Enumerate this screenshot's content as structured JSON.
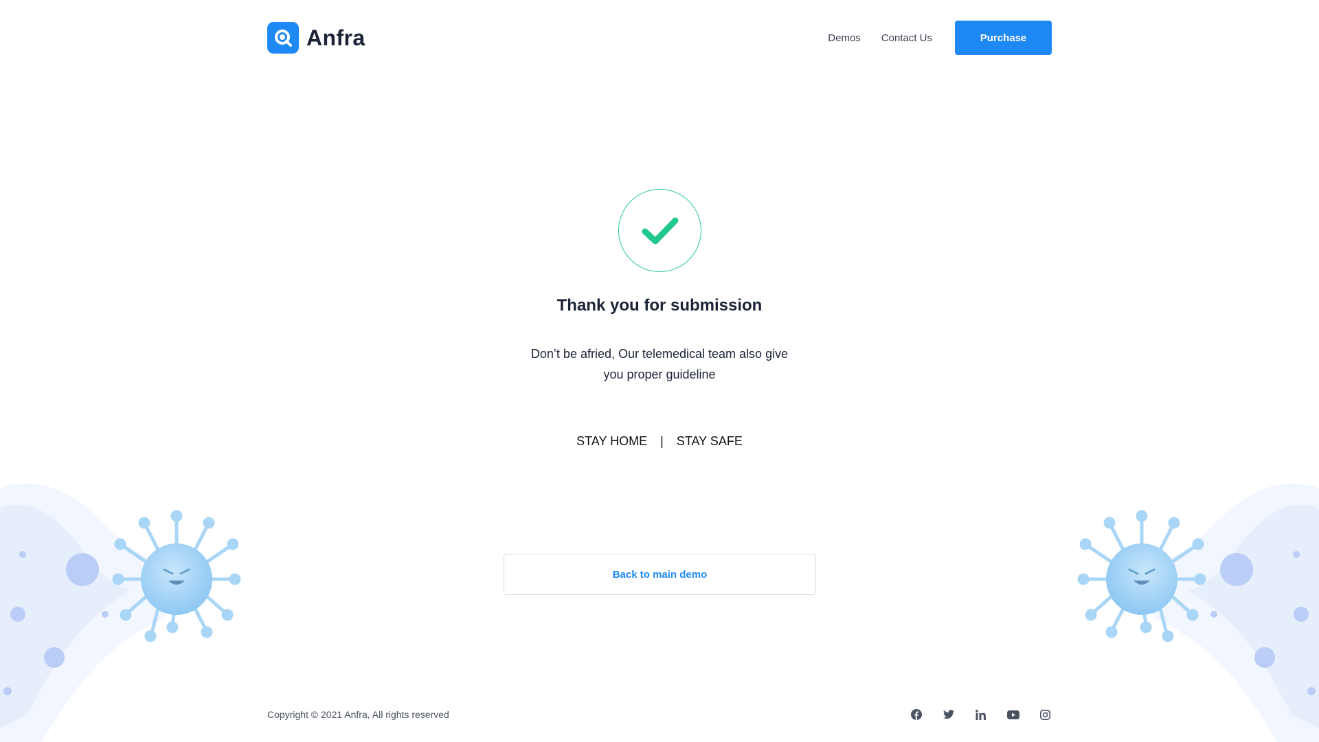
{
  "brand": {
    "name": "Anfra",
    "logo_icon": "search-icon",
    "accent": "#1e88f5"
  },
  "nav": {
    "demos_label": "Demos",
    "contact_label": "Contact Us",
    "purchase_label": "Purchase"
  },
  "main": {
    "status_icon": "checkmark-icon",
    "success_color": "#22c98a",
    "title": "Thank you for submission",
    "message_line1": "Don’t be afried, Our telemedical team also give",
    "message_line2": "you proper guideline",
    "stay_home": "STAY HOME",
    "separator": "|",
    "stay_safe": "STAY SAFE",
    "back_label": "Back to main demo"
  },
  "footer": {
    "copyright": "Copyright © 2021 Anfra, All rights reserved",
    "socials": [
      "facebook-icon",
      "twitter-icon",
      "linkedin-icon",
      "youtube-icon",
      "instagram-icon"
    ]
  }
}
